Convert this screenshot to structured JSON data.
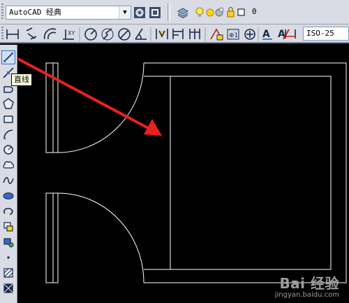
{
  "toolbar": {
    "workspace_value": "AutoCAD 经典",
    "layer_value": "0",
    "dimstyle_value": "ISO-25"
  },
  "tooltip": {
    "text": "直线"
  },
  "watermark": {
    "logo": "Bai 经验",
    "url": "jingyan.baidu.com"
  },
  "colors": {
    "canvas_bg": "#000000",
    "drawing_line": "#ffffff",
    "annotation_arrow": "#e8221a"
  },
  "icons": {
    "row1": [
      "workspace-settings-icon",
      "workspace-toolbar-icon",
      "layer-properties-icon",
      "layer-state-icons"
    ],
    "row2": [
      "linear-dim-icon",
      "aligned-dim-icon",
      "arc-length-icon",
      "ordinate-dim-icon",
      "radius-dim-icon",
      "jogged-dim-icon",
      "diameter-dim-icon",
      "angular-dim-icon",
      "quick-dim-icon",
      "baseline-dim-icon",
      "continue-dim-icon",
      "tolerance-icon",
      "center-mark-icon",
      "dimtedit-icon",
      "dimedit-icon",
      "update-dim-icon"
    ],
    "draw": [
      "line-icon",
      "construction-line-icon",
      "polyline-icon",
      "polygon-icon",
      "rectangle-icon",
      "arc-icon",
      "circle-icon",
      "revision-cloud-icon",
      "spline-icon",
      "ellipse-icon",
      "ellipse-arc-icon",
      "insert-block-icon",
      "make-block-icon",
      "point-icon",
      "hatch-icon",
      "gradient-icon"
    ]
  }
}
